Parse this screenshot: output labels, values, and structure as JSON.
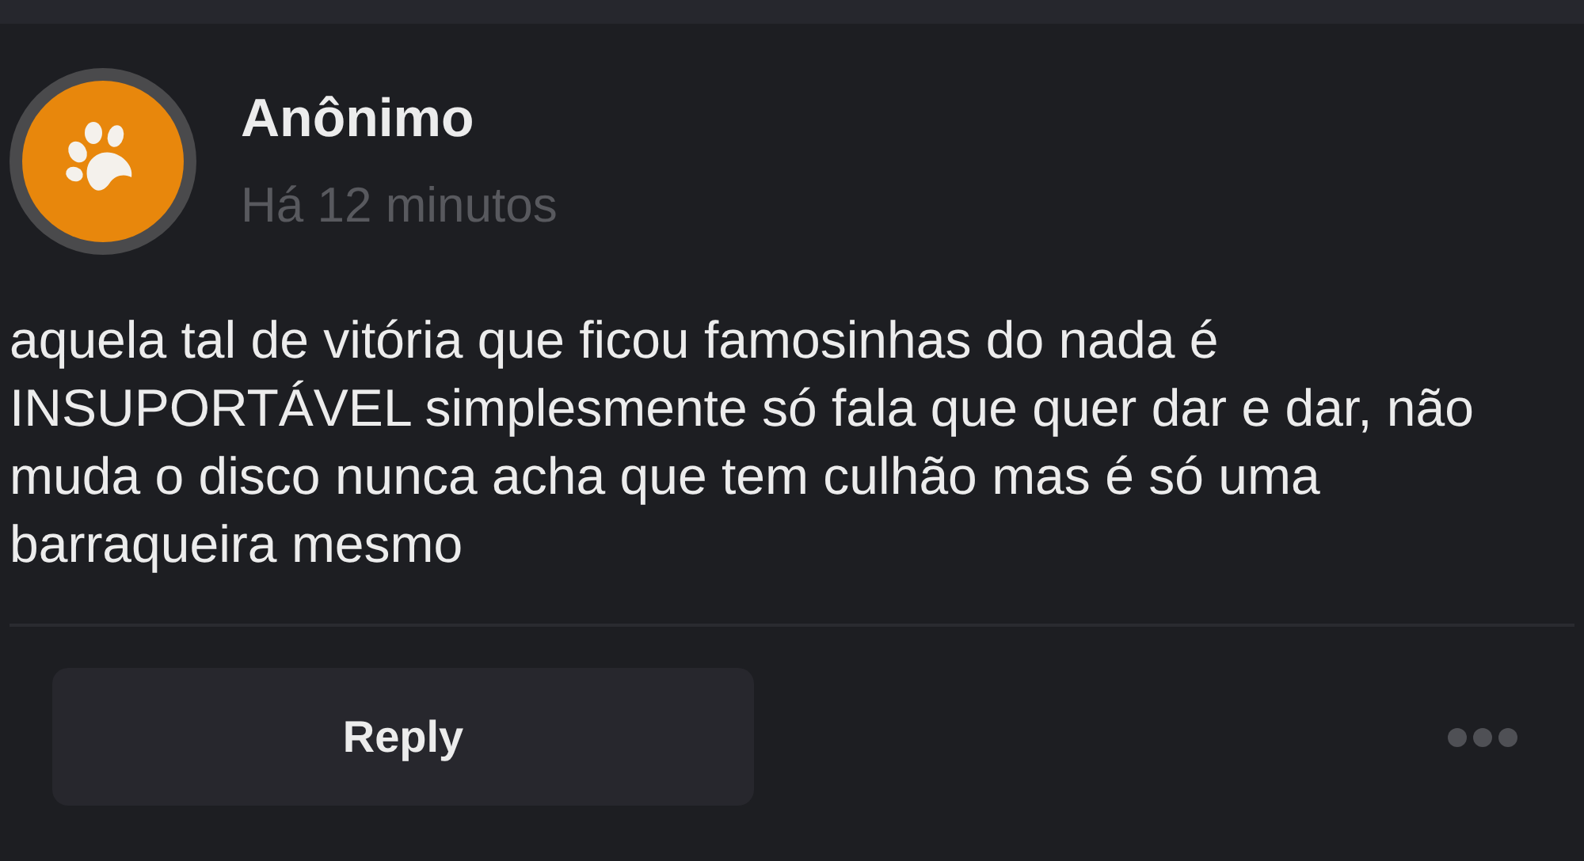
{
  "post": {
    "author": "Anônimo",
    "time": "Há 12 minutos",
    "body": "aquela tal de vitória que ficou famosinhas do nada é INSUPORTÁVEL simplesmente só fala que quer dar e dar, não muda o disco nunca acha que tem culhão mas é só uma barraqueira mesmo"
  },
  "actions": {
    "reply": "Reply"
  }
}
